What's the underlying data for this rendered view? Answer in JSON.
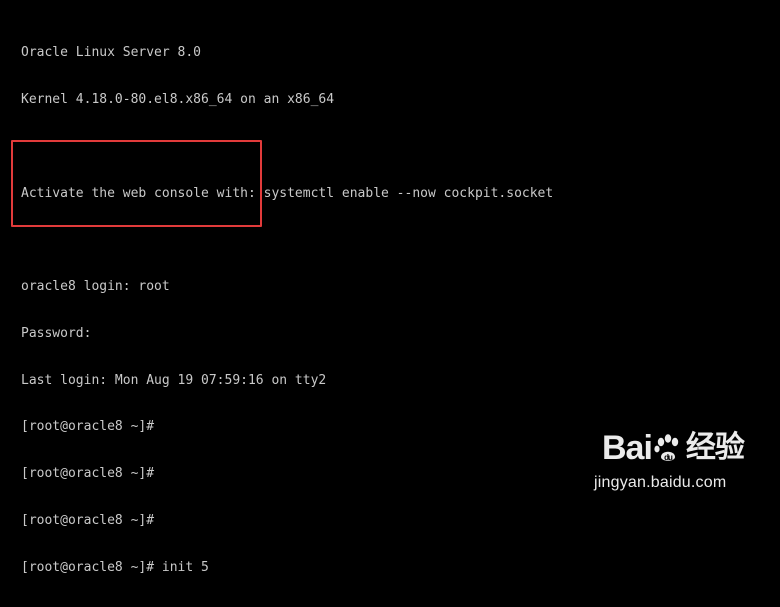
{
  "terminal": {
    "lines": [
      "Oracle Linux Server 8.0",
      "Kernel 4.18.0-80.el8.x86_64 on an x86_64",
      "",
      "Activate the web console with: systemctl enable --now cockpit.socket",
      "",
      "oracle8 login: root",
      "Password:",
      "Last login: Mon Aug 19 07:59:16 on tty2",
      "[root@oracle8 ~]#",
      "[root@oracle8 ~]#",
      "[root@oracle8 ~]#",
      "[root@oracle8 ~]# init 5"
    ],
    "text_color": "#c9c9c9",
    "background": "#000000",
    "highlight_color": "#e23b3b"
  },
  "watermark": {
    "logo_left": "Bai",
    "logo_right": "经验",
    "url": "jingyan.baidu.com"
  }
}
